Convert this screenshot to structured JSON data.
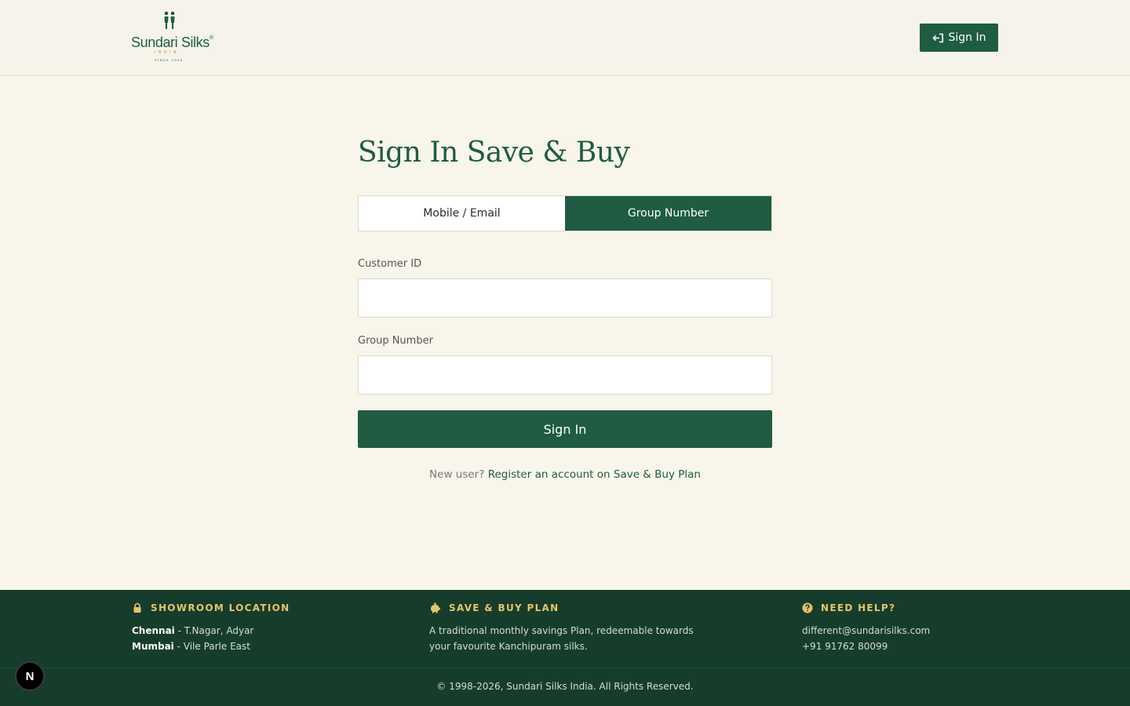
{
  "header": {
    "logo": {
      "name": "Sundari Silks",
      "registered": "®",
      "country": "INDIA",
      "since": "SINCE 1998"
    },
    "signin_label": "Sign In"
  },
  "main": {
    "title": "Sign In Save & Buy",
    "tabs": [
      {
        "label": "Mobile / Email",
        "active": false
      },
      {
        "label": "Group Number",
        "active": true
      }
    ],
    "fields": {
      "customer_id": {
        "label": "Customer ID",
        "value": "",
        "placeholder": ""
      },
      "group_number": {
        "label": "Group Number",
        "value": "",
        "placeholder": ""
      }
    },
    "submit_label": "Sign In",
    "register_prompt": "New user?",
    "register_link": "Register an account on Save & Buy Plan"
  },
  "footer": {
    "showroom": {
      "heading": "SHOWROOM LOCATION",
      "icon": "lock-icon",
      "lines": [
        {
          "city": "Chennai",
          "sep": " - ",
          "area": "T.Nagar, Adyar"
        },
        {
          "city": "Mumbai",
          "sep": " - ",
          "area": "Vile Parle East"
        }
      ]
    },
    "plan": {
      "heading": "SAVE & BUY PLAN",
      "icon": "piggy-bank-icon",
      "line1": "A traditional monthly savings Plan, redeemable towards",
      "line2": "your favourite Kanchipuram silks."
    },
    "help": {
      "heading": "NEED HELP?",
      "icon": "question-circle-icon",
      "email": "different@sundarisilks.com",
      "phone": "+91 91762 80099"
    },
    "copyright": "© 1998-2026, Sundari Silks India. All Rights Reserved."
  },
  "dev_badge": "N",
  "colors": {
    "primary": "#1f5c42",
    "footer_bg": "#163d2c",
    "accent_gold": "#e8c36a",
    "page_bg": "#f8f5eb"
  }
}
